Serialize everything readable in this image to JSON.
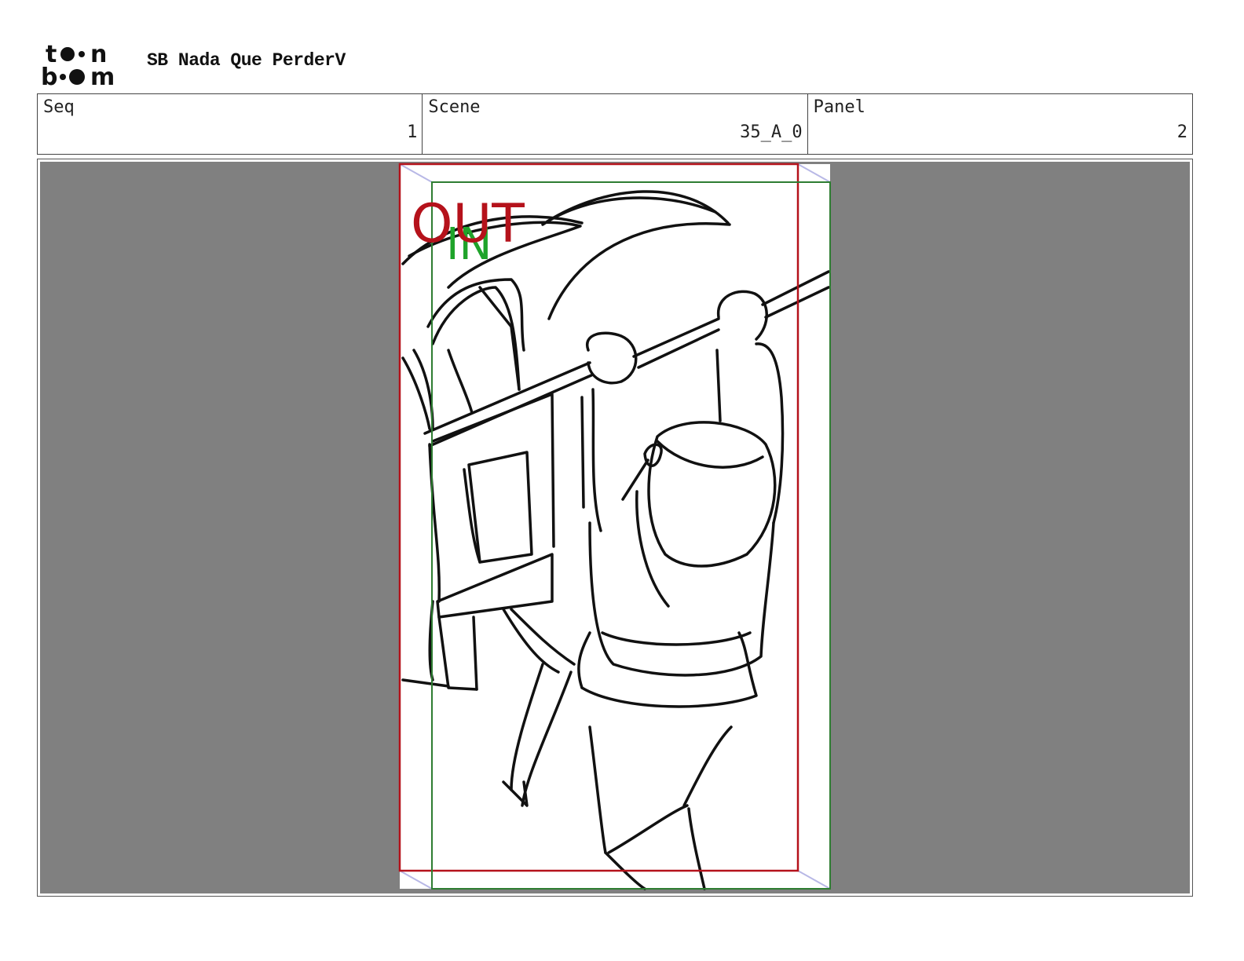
{
  "header": {
    "logo_text": [
      "to",
      "n",
      "b",
      "m"
    ],
    "project_title": "SB Nada Que PerderV"
  },
  "info": {
    "seq_label": "Seq",
    "seq_value": "1",
    "scene_label": "Scene",
    "scene_value": "35_A_0",
    "panel_label": "Panel",
    "panel_value": "2"
  },
  "panel": {
    "out_label": "OUT",
    "in_label": "IN",
    "colors": {
      "background": "#808080",
      "out_frame": "#b5121b",
      "in_frame": "#2e7d32",
      "in_text": "#1fa32a",
      "perspective": "#b8b8e6"
    }
  }
}
